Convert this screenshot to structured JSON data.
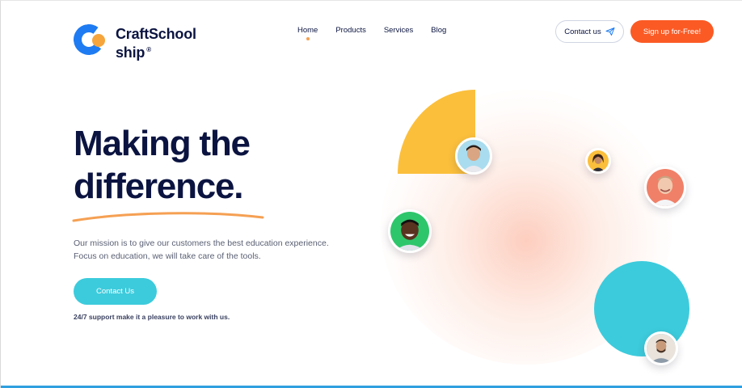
{
  "brand": {
    "name_line1": "CraftSchool",
    "name_line2": "ship",
    "registered": "®",
    "accent_blue": "#1e7bf2",
    "accent_orange": "#f5a53c"
  },
  "nav": {
    "items": [
      {
        "label": "Home",
        "active": true
      },
      {
        "label": "Products"
      },
      {
        "label": "Services"
      },
      {
        "label": "Blog"
      }
    ]
  },
  "header": {
    "contact_label": "Contact us",
    "contact_icon": "paper-plane-icon",
    "signup_label": "Sign up for-Free!",
    "signup_color": "#fb5a24"
  },
  "hero": {
    "title_line1": "Making the",
    "title_line2": "difference.",
    "mission_line1": "Our mission is to give our customers the best education experience.",
    "mission_line2": "Focus on education, we will take care of the tools.",
    "cta_label": "Contact Us",
    "cta_color": "#3ccbdc",
    "support_text": "24/7 support make it a pleasure to work with us."
  },
  "illustration": {
    "shape_yellow": "#fbbf3c",
    "shape_cyan": "#3ccbdc",
    "avatar_count": 5
  }
}
